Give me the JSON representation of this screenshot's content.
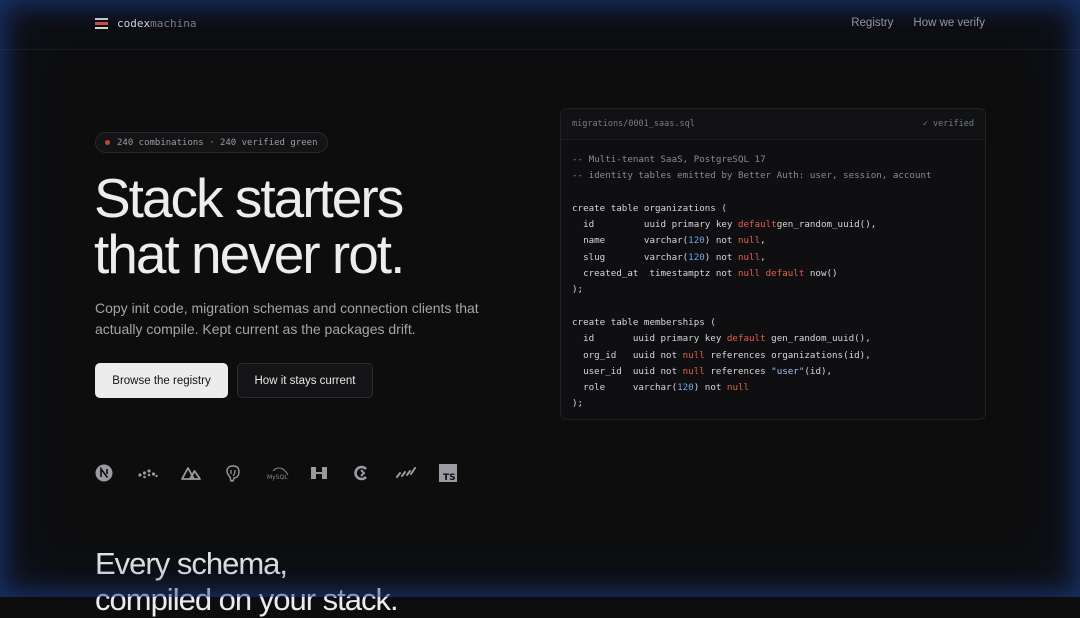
{
  "brand": {
    "name_bold": "codex",
    "name_light": "machina"
  },
  "nav": {
    "links": [
      "Registry",
      "How we verify"
    ]
  },
  "hero": {
    "pill": "240 combinations · 240 verified green",
    "title_line1": "Stack starters",
    "title_line2": "that never rot.",
    "subtitle": "Copy init code, migration schemas and connection clients that actually compile. Kept current as the packages drift.",
    "primary_cta": "Browse the registry",
    "secondary_cta": "How it stays current"
  },
  "code_panel": {
    "filename": "migrations/0001_saas.sql",
    "status": "✓ verified",
    "lines": [
      [
        [
          "cm",
          "-- Multi-tenant SaaS, PostgreSQL 17"
        ]
      ],
      [
        [
          "cm",
          "-- identity tables emitted by Better Auth: user, session, account"
        ]
      ],
      [],
      [
        [
          "",
          "create table organizations ("
        ]
      ],
      [
        [
          "",
          "  id         uuid primary key "
        ],
        [
          "kw",
          "default"
        ],
        [
          "",
          "gen_random_uuid(),"
        ]
      ],
      [
        [
          "",
          "  name       varchar("
        ],
        [
          "nm",
          "120"
        ],
        [
          "",
          ") not "
        ],
        [
          "kw",
          "null"
        ],
        [
          "",
          ","
        ]
      ],
      [
        [
          "",
          "  slug       varchar("
        ],
        [
          "nm",
          "120"
        ],
        [
          "",
          ") not "
        ],
        [
          "kw",
          "null"
        ],
        [
          "",
          ","
        ]
      ],
      [
        [
          "",
          "  created_at  timestamptz not "
        ],
        [
          "kw",
          "null"
        ],
        [
          "",
          ""
        ],
        [
          "kw",
          " default"
        ],
        [
          "",
          " now()"
        ]
      ],
      [
        [
          "",
          ");"
        ]
      ],
      [],
      [
        [
          "",
          "create table memberships ("
        ]
      ],
      [
        [
          "",
          "  id       uuid primary key "
        ],
        [
          "kw",
          "default"
        ],
        [
          "",
          " gen_random_uuid(),"
        ]
      ],
      [
        [
          "",
          "  org_id   uuid not "
        ],
        [
          "kw",
          "null"
        ],
        [
          "",
          " references organizations(id),"
        ]
      ],
      [
        [
          "",
          "  user_id  uuid not "
        ],
        [
          "kw",
          "null"
        ],
        [
          "",
          " references "
        ],
        [
          "st",
          "\"user\""
        ],
        [
          "",
          "(id),"
        ]
      ],
      [
        [
          "",
          "  role     varchar("
        ],
        [
          "nm",
          "120"
        ],
        [
          "",
          ") not "
        ],
        [
          "kw",
          "null"
        ]
      ],
      [
        [
          "",
          ");"
        ]
      ]
    ]
  },
  "tech_logos": [
    "nextjs-icon",
    "prisma-dots-icon",
    "nuxt-icon",
    "postgresql-icon",
    "mysql-icon",
    "hono-icon",
    "convex-icon",
    "drizzle-icon",
    "typescript-icon"
  ],
  "section2": {
    "title_line1": "Every schema,",
    "title_line2": "compiled on your stack."
  }
}
